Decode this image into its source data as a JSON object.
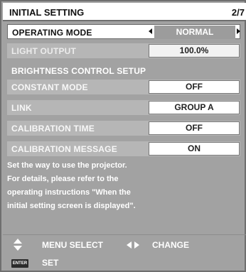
{
  "header": {
    "title": "INITIAL SETTING",
    "page": "2/7"
  },
  "items": {
    "operating_mode": {
      "label": "OPERATING MODE",
      "value": "NORMAL"
    },
    "light_output": {
      "label": "LIGHT OUTPUT",
      "value": "100.0%"
    },
    "brightness_section": {
      "label": "BRIGHTNESS CONTROL SETUP"
    },
    "constant_mode": {
      "label": "CONSTANT MODE",
      "value": "OFF"
    },
    "link": {
      "label": "LINK",
      "value": "GROUP A"
    },
    "calibration_time": {
      "label": "CALIBRATION TIME",
      "value": "OFF"
    },
    "calibration_message": {
      "label": "CALIBRATION MESSAGE",
      "value": "ON"
    }
  },
  "description": [
    "Set the way to use the projector.",
    "For details, please refer to the",
    "operating instructions \"When the",
    "initial setting screen is displayed\"."
  ],
  "footer": {
    "menu_select": "MENU SELECT",
    "change": "CHANGE",
    "enter_key": "ENTER",
    "set": "SET"
  },
  "icons": {
    "updown": "up-down-arrows-icon",
    "leftright": "left-right-arrows-icon",
    "enter": "enter-key-icon"
  }
}
